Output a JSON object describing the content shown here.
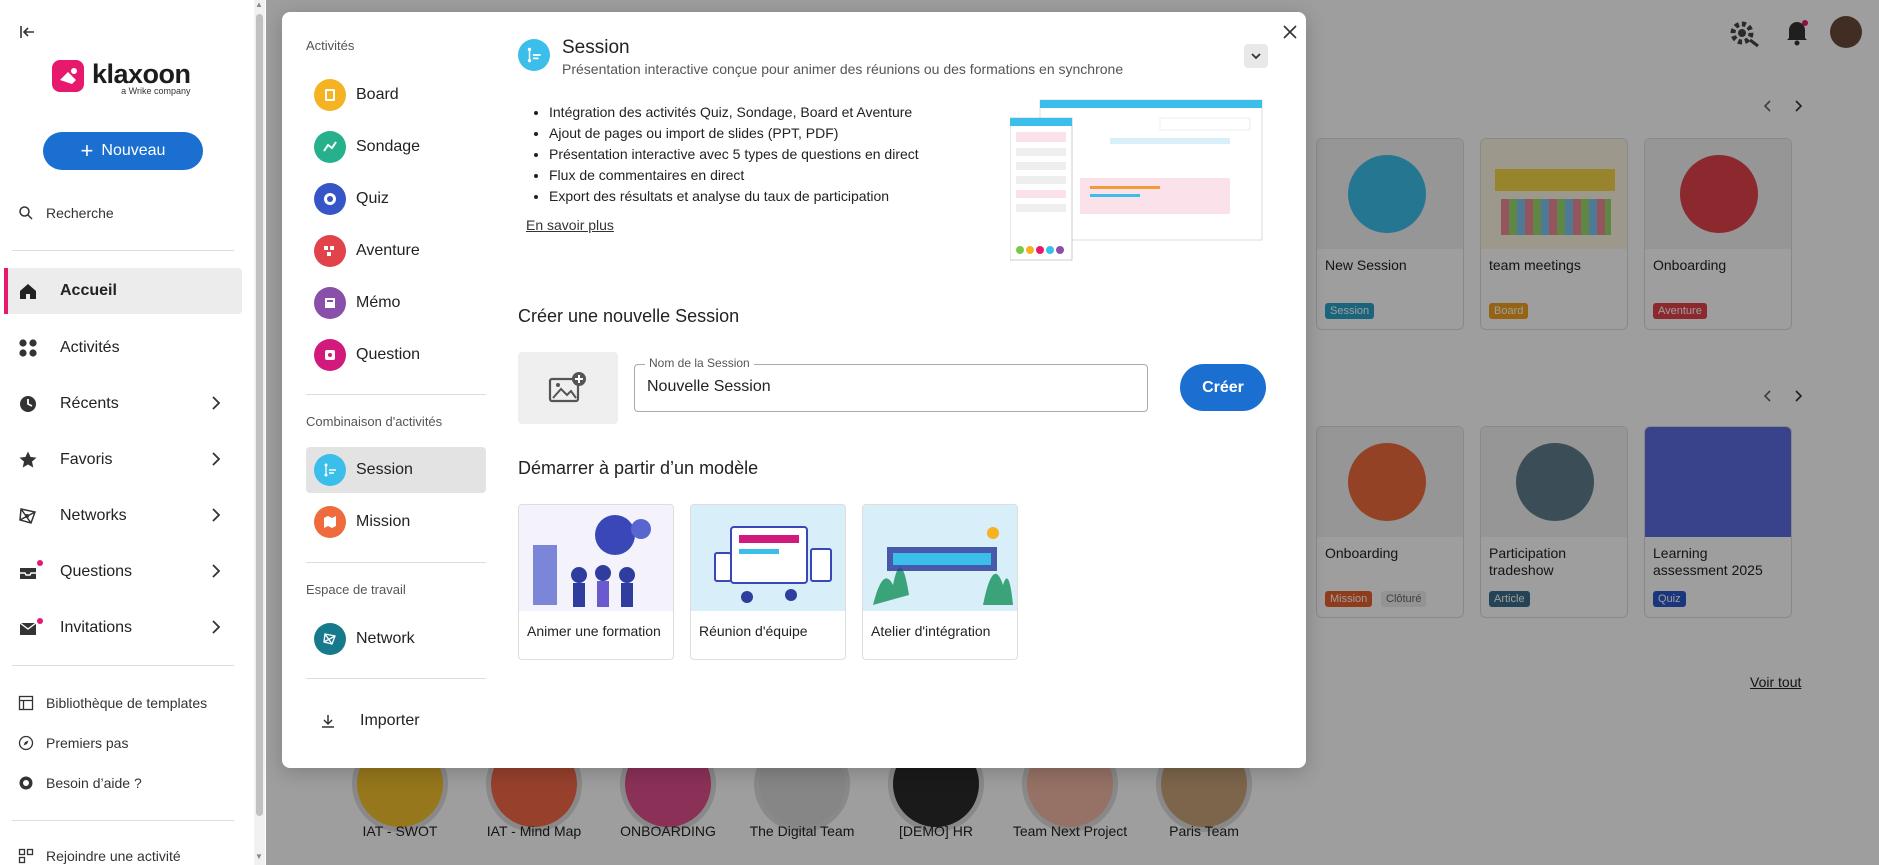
{
  "sidebar": {
    "logo": {
      "name": "klaxoon",
      "sub": "a Wrike company"
    },
    "new_button": "Nouveau",
    "search": "Recherche",
    "nav": [
      {
        "label": "Accueil",
        "icon": "home-icon",
        "active": true
      },
      {
        "label": "Activités",
        "icon": "grid-icon"
      },
      {
        "label": "Récents",
        "icon": "clock-icon",
        "has_chevron": true
      },
      {
        "label": "Favoris",
        "icon": "star-icon",
        "has_chevron": true
      },
      {
        "label": "Networks",
        "icon": "network-icon",
        "has_chevron": true
      },
      {
        "label": "Questions",
        "icon": "inbox-icon",
        "has_chevron": true,
        "badge": true
      },
      {
        "label": "Invitations",
        "icon": "mail-icon",
        "has_chevron": true,
        "badge": true
      }
    ],
    "bottom": [
      {
        "label": "Bibliothèque de templates",
        "icon": "templates-icon"
      },
      {
        "label": "Premiers pas",
        "icon": "compass-icon"
      },
      {
        "label": "Besoin d’aide ?",
        "icon": "help-icon"
      },
      {
        "label": "Rejoindre une activité",
        "icon": "qr-icon"
      }
    ]
  },
  "background": {
    "cards_row1": [
      {
        "title": "New Session",
        "tag": "Session",
        "tag_color": "#2aa3c8"
      },
      {
        "title": "team meetings",
        "tag": "Board",
        "tag_color": "#f0a020"
      },
      {
        "title": "Onboarding",
        "tag": "Aventure",
        "tag_color": "#e2434b"
      }
    ],
    "cards_row2": [
      {
        "title": "Onboarding",
        "tag": "Mission",
        "tag_color": "#e9602e",
        "tag2": "Clôturé"
      },
      {
        "title": "Participation tradeshow",
        "tag": "Article",
        "tag_color": "#3a6e8a"
      },
      {
        "title": "Learning assessment 2025",
        "tag": "Quiz",
        "tag_color": "#2c58c8"
      }
    ],
    "see_all": "Voir tout",
    "networks": [
      "IAT - SWOT",
      "IAT - Mind Map",
      "ONBOARDING",
      "The Digital Team",
      "[DEMO] HR",
      "Team Next Project",
      "Paris Team"
    ]
  },
  "modal": {
    "sections": {
      "activities": "Activités",
      "combos": "Combinaison d'activités",
      "workspace": "Espace de travail"
    },
    "activities": [
      {
        "label": "Board",
        "icon": "board-icon",
        "color": "#f5b324"
      },
      {
        "label": "Sondage",
        "icon": "survey-icon",
        "color": "#27b08c"
      },
      {
        "label": "Quiz",
        "icon": "quiz-icon",
        "color": "#3656c8"
      },
      {
        "label": "Aventure",
        "icon": "adventure-icon",
        "color": "#e2434b"
      },
      {
        "label": "Mémo",
        "icon": "memo-icon",
        "color": "#8a4fa8"
      },
      {
        "label": "Question",
        "icon": "question-icon",
        "color": "#d21a7c"
      }
    ],
    "combos": [
      {
        "label": "Session",
        "icon": "session-icon",
        "color": "#3bbfea",
        "selected": true
      },
      {
        "label": "Mission",
        "icon": "mission-icon",
        "color": "#ef6b3d"
      }
    ],
    "workspace": [
      {
        "label": "Network",
        "icon": "network-icon",
        "color": "#177a8c"
      }
    ],
    "import": "Importer",
    "detail": {
      "title": "Session",
      "description": "Présentation interactive conçue pour animer des réunions ou des formations en synchrone",
      "features": [
        "Intégration des activités Quiz, Sondage, Board et Aventure",
        "Ajout de pages ou import de slides (PPT, PDF)",
        "Présentation interactive avec 5 types de questions en direct",
        "Flux de commentaires en direct",
        "Export des résultats et analyse du taux de participation"
      ],
      "learn_more": "En savoir plus"
    },
    "create": {
      "heading": "Créer une nouvelle Session",
      "field_label": "Nom de la Session",
      "field_value": "Nouvelle Session",
      "button": "Créer"
    },
    "templates": {
      "heading": "Démarrer à partir d’un modèle",
      "items": [
        {
          "label": "Animer une formation"
        },
        {
          "label": "Réunion d'équipe"
        },
        {
          "label": "Atelier d'intégration"
        }
      ]
    }
  }
}
